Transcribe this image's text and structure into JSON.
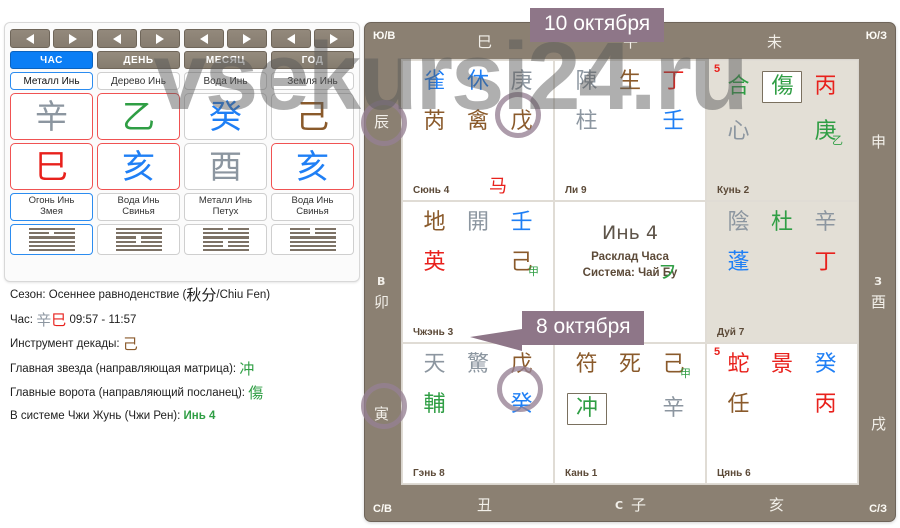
{
  "watermark": "vsekursi24.ru",
  "left_panel": {
    "nav_prev_icon": "triangle-left-icon",
    "nav_next_icon": "triangle-right-icon",
    "pillars": [
      {
        "tab": "ЧАС",
        "active": true,
        "element": "Металл Инь",
        "stem": "辛",
        "stem_color": "metal",
        "branch": "巳",
        "branch_color": "fire",
        "animal": "Огонь Инь\nЗмея",
        "animal_l1": "Огонь Инь",
        "animal_l2": "Змея",
        "hexagram": "101111"
      },
      {
        "tab": "ДЕНЬ",
        "active": false,
        "element": "Дерево Инь",
        "stem": "乙",
        "stem_color": "wood",
        "branch": "亥",
        "branch_color": "water",
        "animal_l1": "Вода Инь",
        "animal_l2": "Свинья",
        "hexagram": "110011"
      },
      {
        "tab": "МЕСЯЦ",
        "active": false,
        "element": "Вода Инь",
        "stem": "癸",
        "stem_color": "water",
        "branch": "酉",
        "branch_color": "metal",
        "animal_l1": "Металл Инь",
        "animal_l2": "Петух",
        "hexagram": "011001"
      },
      {
        "tab": "ГОД",
        "active": false,
        "element": "Земля Инь",
        "stem": "己",
        "stem_color": "earth",
        "branch": "亥",
        "branch_color": "water",
        "animal_l1": "Вода Инь",
        "animal_l2": "Свинья",
        "hexagram": "001111"
      }
    ]
  },
  "info": {
    "season_label": "Сезон:",
    "season_value": "Осеннее равноденствие (",
    "season_hanzi": "秋分",
    "season_tail": "/Chiu Fen)",
    "hour_label": "Час:",
    "hour_stem": "辛",
    "hour_branch": "巳",
    "hour_range": "09:57 - 11:57",
    "decade_label": "Инструмент декады:",
    "decade_value": "己",
    "star_label": "Главная звезда (направляющая матрица):",
    "star_value": "冲",
    "gate_label": "Главные ворота (направляющий посланец):",
    "gate_value": "傷",
    "zhirun_label": "В системе Чжи Жунь (Чжи Рен):",
    "zhirun_value": "Инь 4"
  },
  "board": {
    "corners": {
      "tl": "Ю/В",
      "tr": "Ю/З",
      "bl": "С/В",
      "br": "С/З"
    },
    "edges": {
      "top": [
        "巳",
        "午",
        "未"
      ],
      "bottom": [
        "丑",
        "子",
        "亥"
      ],
      "bottom_dir": "С",
      "left": [
        "辰",
        "卯",
        "寅"
      ],
      "left_dir": "В",
      "right": [
        "申",
        "酉",
        "戌"
      ],
      "right_dir": "З"
    },
    "palaces": [
      {
        "id": "xun4",
        "name": "Сюнь 4",
        "shaded": false,
        "corner_num": "",
        "row1": [
          {
            "ch": "雀",
            "color": "water"
          },
          {
            "ch": "休",
            "color": "water"
          },
          {
            "ch": "庚",
            "color": "grey",
            "sup": "",
            "sup_color": ""
          }
        ],
        "row2": [
          {
            "ch": "芮",
            "color": "earth"
          },
          {
            "ch": "禽",
            "color": "earth"
          },
          {
            "ch": "戊",
            "color": "earth"
          }
        ],
        "extra": {
          "ch": "马",
          "color": "fire",
          "pos": "row3-mid"
        }
      },
      {
        "id": "li9",
        "name": "Ли 9",
        "shaded": false,
        "corner_num": "",
        "row1": [
          {
            "ch": "陳",
            "color": "grey"
          },
          {
            "ch": "生",
            "color": "earth"
          },
          {
            "ch": "丁",
            "color": "fire"
          }
        ],
        "row2": [
          {
            "ch": "柱",
            "color": "grey"
          },
          {
            "ch": "",
            "color": ""
          },
          {
            "ch": "壬",
            "color": "water"
          }
        ]
      },
      {
        "id": "kun2",
        "name": "Кунь 2",
        "shaded": true,
        "corner_num": "5",
        "row1": [
          {
            "ch": "合",
            "color": "wood"
          },
          {
            "ch": "傷",
            "color": "wood",
            "boxed": true
          },
          {
            "ch": "丙",
            "color": "fire"
          }
        ],
        "row2": [
          {
            "ch": "心",
            "color": "grey"
          },
          {
            "ch": "",
            "color": ""
          },
          {
            "ch": "庚",
            "color": "wood",
            "sup": "乙",
            "sup_color": "wood"
          }
        ]
      },
      {
        "id": "zhen3",
        "name": "Чжэнь 3",
        "shaded": false,
        "corner_num": "",
        "row1": [
          {
            "ch": "地",
            "color": "earth"
          },
          {
            "ch": "開",
            "color": "grey"
          },
          {
            "ch": "壬",
            "color": "water"
          }
        ],
        "row2": [
          {
            "ch": "英",
            "color": "fire"
          },
          {
            "ch": "",
            "color": ""
          },
          {
            "ch": "己",
            "color": "earth",
            "sup": "甲",
            "sup_color": "wood"
          }
        ]
      },
      {
        "id": "center",
        "name": "",
        "center": true,
        "title": "Инь 4",
        "sub1": "Расклад Часа",
        "sub2": "Система: Чай Бу",
        "mark": "フ"
      },
      {
        "id": "dui7",
        "name": "Дуй 7",
        "shaded": true,
        "corner_num": "",
        "row1": [
          {
            "ch": "陰",
            "color": "grey"
          },
          {
            "ch": "杜",
            "color": "wood"
          },
          {
            "ch": "辛",
            "color": "grey"
          }
        ],
        "row2": [
          {
            "ch": "蓬",
            "color": "water"
          },
          {
            "ch": "",
            "color": ""
          },
          {
            "ch": "丁",
            "color": "fire"
          }
        ]
      },
      {
        "id": "gen8",
        "name": "Гэнь 8",
        "shaded": false,
        "corner_num": "",
        "row1": [
          {
            "ch": "天",
            "color": "grey"
          },
          {
            "ch": "驚",
            "color": "grey"
          },
          {
            "ch": "戊",
            "color": "earth"
          }
        ],
        "row2": [
          {
            "ch": "輔",
            "color": "wood"
          },
          {
            "ch": "",
            "color": ""
          },
          {
            "ch": "癸",
            "color": "water"
          }
        ]
      },
      {
        "id": "kan1",
        "name": "Кань 1",
        "shaded": false,
        "corner_num": "",
        "row1": [
          {
            "ch": "符",
            "color": "earth"
          },
          {
            "ch": "死",
            "color": "earth"
          },
          {
            "ch": "己",
            "color": "earth",
            "sup": "甲",
            "sup_color": "wood"
          }
        ],
        "row2": [
          {
            "ch": "冲",
            "color": "wood",
            "boxed": true
          },
          {
            "ch": "",
            "color": ""
          },
          {
            "ch": "辛",
            "color": "grey"
          }
        ]
      },
      {
        "id": "qian6",
        "name": "Цянь 6",
        "shaded": false,
        "corner_num": "5",
        "row1": [
          {
            "ch": "蛇",
            "color": "fire"
          },
          {
            "ch": "景",
            "color": "fire"
          },
          {
            "ch": "癸",
            "color": "water"
          }
        ],
        "row2": [
          {
            "ch": "任",
            "color": "earth"
          },
          {
            "ch": "",
            "color": ""
          },
          {
            "ch": "丙",
            "color": "fire"
          }
        ]
      }
    ]
  },
  "callouts": [
    {
      "id": "oct10",
      "text": "10 октября"
    },
    {
      "id": "oct8",
      "text": "8 октября"
    }
  ]
}
